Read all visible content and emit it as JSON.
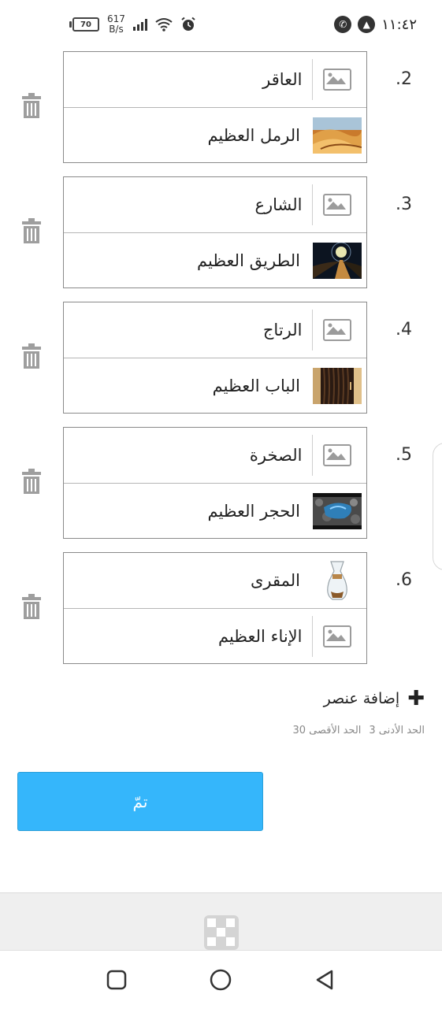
{
  "status_bar": {
    "battery": "70",
    "net_speed_value": "617",
    "net_speed_unit": "B/s",
    "time": "١١:٤٢"
  },
  "rows": [
    {
      "number": ".2",
      "top_label": "العاقر",
      "bottom_label": "الرمل العظيم",
      "top_image": "image-placeholder-icon",
      "bottom_image": "desert-dunes-photo"
    },
    {
      "number": ".3",
      "top_label": "الشارع",
      "bottom_label": "الطريق العظيم",
      "top_image": "image-placeholder-icon",
      "bottom_image": "road-photo"
    },
    {
      "number": ".4",
      "top_label": "الرتاج",
      "bottom_label": "الباب العظيم",
      "top_image": "image-placeholder-icon",
      "bottom_image": "door-photo"
    },
    {
      "number": ".5",
      "top_label": "الصخرة",
      "bottom_label": "الحجر العظيم",
      "top_image": "image-placeholder-icon",
      "bottom_image": "stone-photo"
    },
    {
      "number": ".6",
      "top_label": "المقرى",
      "bottom_label": "الإناء العظيم",
      "top_image": "coffee-pot-photo",
      "bottom_image": "image-placeholder-icon"
    }
  ],
  "add_item": {
    "label": "إضافة عنصر"
  },
  "limits": {
    "min": "الحد الأدنى 3",
    "max": "الحد الأقصى 30"
  },
  "done_button": {
    "label": "تمّ"
  },
  "colors": {
    "accent": "#35b6fb",
    "border": "#8a8a8a"
  }
}
